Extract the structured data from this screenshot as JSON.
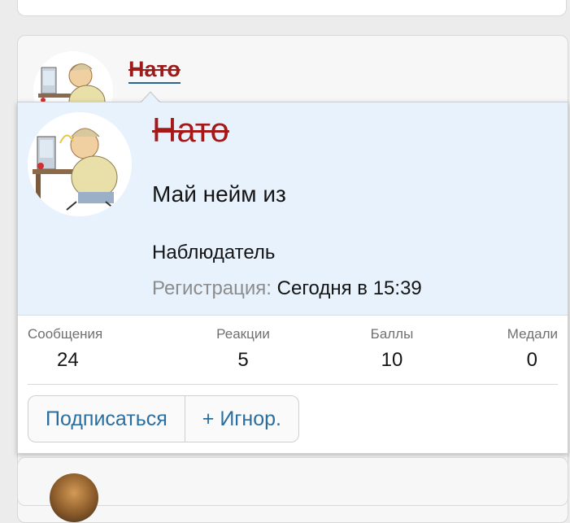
{
  "post": {
    "username": "Нато"
  },
  "tooltip": {
    "name": "Нато",
    "custom_title": "Май нейм из",
    "role": "Наблюдатель",
    "registration_label": "Регистрация:",
    "registration_value": "Сегодня в 15:39",
    "stats": [
      {
        "label": "Сообщения",
        "value": "24"
      },
      {
        "label": "Реакции",
        "value": "5"
      },
      {
        "label": "Баллы",
        "value": "10"
      },
      {
        "label": "Медали",
        "value": "0"
      }
    ],
    "buttons": {
      "follow": "Подписаться",
      "ignore": "+ Игнор."
    }
  },
  "icons": {
    "avatar": "user-avatar-cartoon"
  },
  "colors": {
    "username": "#9c1c1c",
    "tooltip_header_bg": "#e8f2fd",
    "link": "#2a6ea0"
  }
}
